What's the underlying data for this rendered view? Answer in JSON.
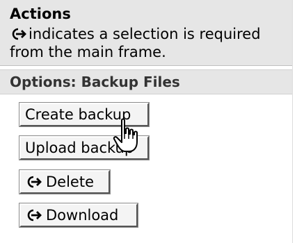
{
  "actions": {
    "title": "Actions",
    "description": "indicates a selection is required from the main frame.",
    "indicator_icon": "selection-required-arrow-icon"
  },
  "options": {
    "label": "Options: Backup Files"
  },
  "buttons": {
    "create_backup": "Create backup",
    "upload_backup": "Upload backup",
    "delete": "Delete",
    "download": "Download"
  },
  "cursor": {
    "icon": "hand-pointer-icon"
  },
  "colors": {
    "panel_background": "#e6e6e6",
    "button_background": "#f4f4f4"
  }
}
